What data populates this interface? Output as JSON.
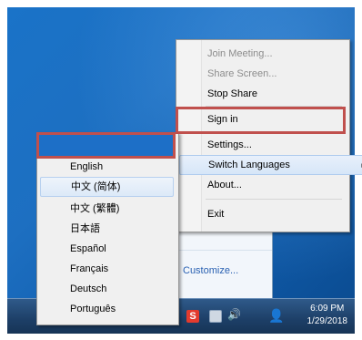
{
  "context_menu": {
    "items": [
      {
        "label": "Join Meeting...",
        "state": "disabled"
      },
      {
        "label": "Share Screen...",
        "state": "disabled"
      },
      {
        "label": "Stop Share",
        "state": "enabled"
      },
      {
        "label": "Sign in",
        "state": "enabled"
      },
      {
        "label": "Settings...",
        "state": "enabled"
      },
      {
        "label": "Switch Languages",
        "state": "highlighted",
        "has_submenu": true
      },
      {
        "label": "About...",
        "state": "enabled"
      },
      {
        "label": "Exit",
        "state": "enabled"
      }
    ],
    "submenu_arrow": "▸"
  },
  "language_menu": {
    "items": [
      {
        "label": "English"
      },
      {
        "label": "中文 (简体)",
        "selected": true
      },
      {
        "label": "中文 (繁體)"
      },
      {
        "label": "日本語"
      },
      {
        "label": "Español"
      },
      {
        "label": "Français"
      },
      {
        "label": "Deutsch"
      },
      {
        "label": "Português"
      }
    ]
  },
  "tray_flyout": {
    "customize_label": "Customize..."
  },
  "taskbar": {
    "time": "6:09 PM",
    "date": "1/29/2018",
    "icons": [
      "app-s-icon",
      "network-icon",
      "volume-icon",
      "user-icon"
    ]
  },
  "annotations": {
    "color": "#c0504d"
  }
}
